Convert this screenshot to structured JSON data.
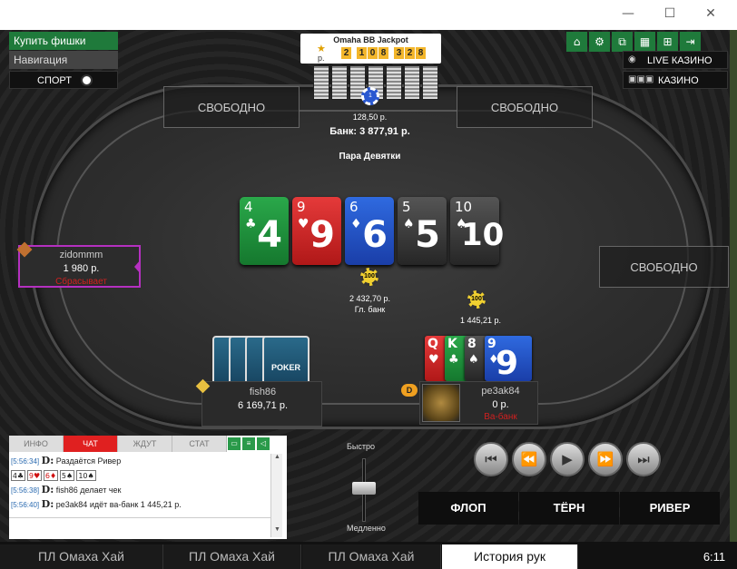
{
  "window": {
    "minimize": "—",
    "maximize": "☐",
    "close": "✕"
  },
  "menu": {
    "buy_chips": "Купить фишки",
    "navigation": "Навигация",
    "sport": "СПОРТ"
  },
  "toolbar": {
    "icons": [
      "home-icon",
      "gear-icon",
      "tables-icon",
      "grid-icon",
      "add-table-icon",
      "exit-icon"
    ]
  },
  "casino": {
    "live": "LIVE КАЗИНО",
    "casino": "КАЗИНО"
  },
  "jackpot": {
    "title": "Omaha BB Jackpot",
    "currency": "р.",
    "digits": [
      "2",
      "1",
      "0",
      "8",
      "3",
      "2",
      "8"
    ]
  },
  "table": {
    "free_seat": "СВОБОДНО",
    "pot_chip": "1",
    "pot_amount": "128,50 р.",
    "bank": "Банк: 3 877,91 р.",
    "hand_name": "Пара Девятки",
    "main_pot_chip": "100",
    "main_pot_amount": "2 432,70 р.",
    "main_pot_label": "Гл. банк",
    "side_pot_chip": "100",
    "side_pot_amount": "1 445,21 р.",
    "board": [
      {
        "rank": "4",
        "suit": "♣",
        "color": "green"
      },
      {
        "rank": "9",
        "suit": "♥",
        "color": "red"
      },
      {
        "rank": "6",
        "suit": "♦",
        "color": "blue"
      },
      {
        "rank": "5",
        "suit": "♠",
        "color": "black"
      },
      {
        "rank": "10",
        "suit": "♠",
        "color": "black"
      }
    ]
  },
  "players": {
    "left": {
      "name": "zidommm",
      "stack": "1 980 р.",
      "action": "Сбрасывает"
    },
    "me": {
      "name": "fish86",
      "stack": "6 169,71 р.",
      "card_back": "POKER"
    },
    "right": {
      "name": "pe3ak84",
      "stack": "0 р.",
      "action": "Ва-банк",
      "dealer": "D",
      "cards": [
        {
          "rank": "Q",
          "suit": "♥",
          "color": "red"
        },
        {
          "rank": "K",
          "suit": "♣",
          "color": "green"
        },
        {
          "rank": "8",
          "suit": "♠",
          "color": "black"
        },
        {
          "rank": "9",
          "suit": "♦",
          "color": "blue"
        }
      ]
    }
  },
  "chat": {
    "tabs": [
      "ИНФО",
      "ЧАТ",
      "ЖДУТ",
      "СТАТ"
    ],
    "lines": [
      {
        "time": "[5:56:34]",
        "d": "D:",
        "text": "Раздаётся Ривер"
      },
      {
        "time": "[5:56:38]",
        "d": "D:",
        "text": "fish86  делает чек"
      },
      {
        "time": "[5:56:40]",
        "d": "D:",
        "text": "pe3ak84  идёт ва-банк 1 445,21 р."
      }
    ],
    "river_cards": [
      {
        "rank": "4",
        "suit": "♣",
        "red": false
      },
      {
        "rank": "9",
        "suit": "♥",
        "red": true
      },
      {
        "rank": "6",
        "suit": "♦",
        "red": true
      },
      {
        "rank": "5",
        "suit": "♠",
        "red": false
      },
      {
        "rank": "10",
        "suit": "♠",
        "red": false
      }
    ]
  },
  "replay": {
    "fast": "Быстро",
    "slow": "Медленно",
    "flop": "ФЛОП",
    "turn": "ТЁРН",
    "river": "РИВЕР"
  },
  "bottom_tabs": [
    "ПЛ Омаха Хай",
    "ПЛ Омаха Хай",
    "ПЛ Омаха Хай",
    "История рук"
  ],
  "clock": "6:11"
}
